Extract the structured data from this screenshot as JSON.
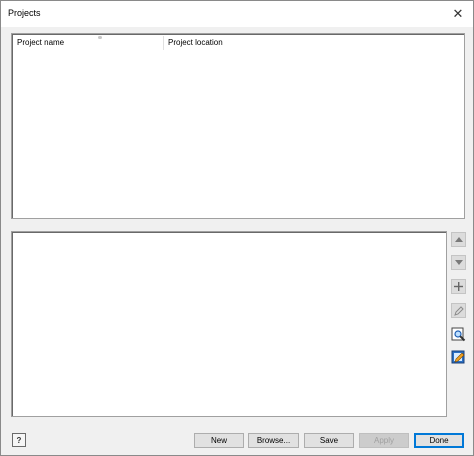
{
  "window": {
    "title": "Projects",
    "close_glyph": "✕"
  },
  "table": {
    "columns": [
      {
        "label": "Project name"
      },
      {
        "label": "Project location"
      }
    ],
    "rows": []
  },
  "side_toolbar": {
    "icons": [
      "move-up-icon",
      "move-down-icon",
      "add-icon",
      "edit-pencil-icon",
      "search-browse-icon",
      "edit-properties-icon"
    ]
  },
  "footer": {
    "help_glyph": "?",
    "buttons": {
      "new": "New",
      "browse": "Browse...",
      "save": "Save",
      "apply": "Apply",
      "done": "Done"
    }
  },
  "colors": {
    "accent": "#0078d7",
    "dialog_bg": "#f0f0f0",
    "disabled_text": "#a0a0a0"
  }
}
